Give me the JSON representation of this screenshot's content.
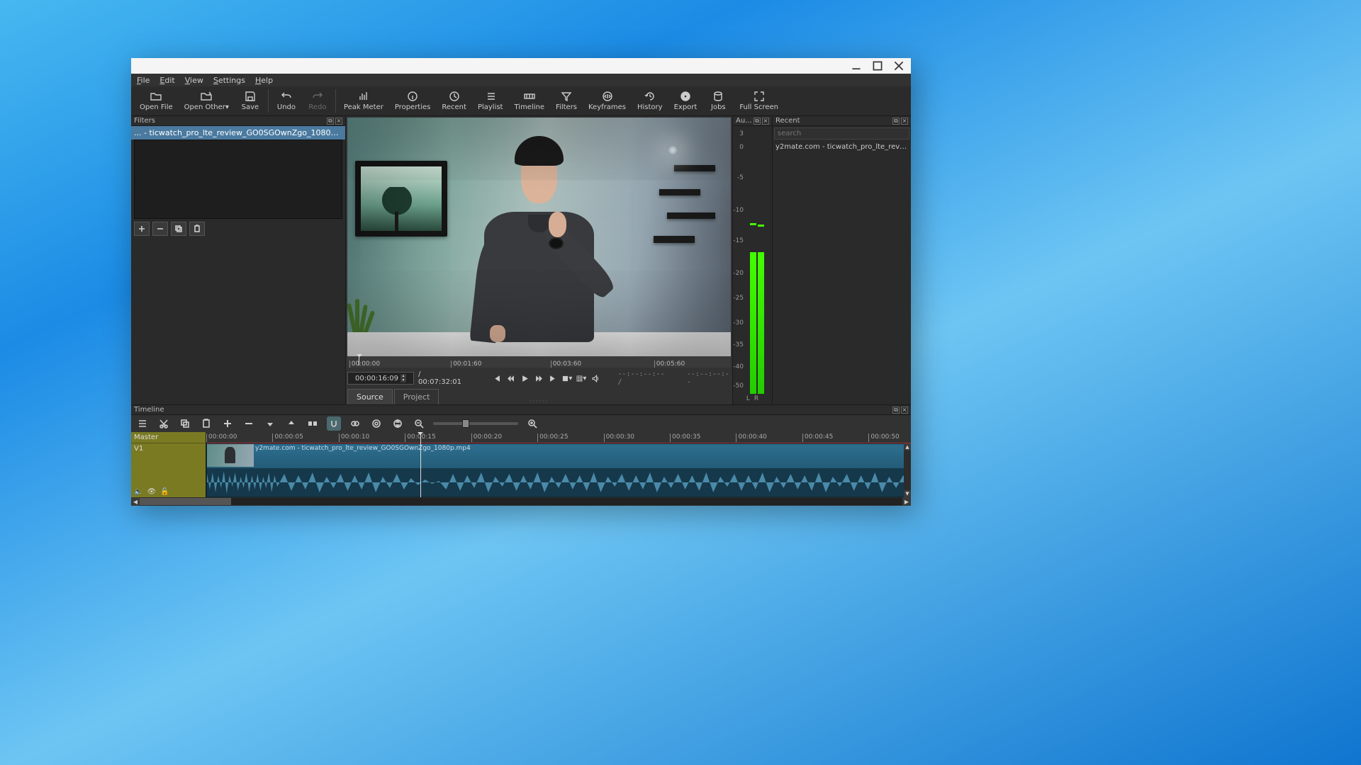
{
  "window": {
    "minimize": "_",
    "maximize": "□",
    "close": "×"
  },
  "menu": [
    "File",
    "Edit",
    "View",
    "Settings",
    "Help"
  ],
  "toolbar": [
    {
      "label": "Open File",
      "icon": "open"
    },
    {
      "label": "Open Other",
      "icon": "open-other",
      "dropdown": true
    },
    {
      "label": "Save",
      "icon": "save"
    },
    {
      "sep": true
    },
    {
      "label": "Undo",
      "icon": "undo"
    },
    {
      "label": "Redo",
      "icon": "redo",
      "disabled": true
    },
    {
      "sep": true
    },
    {
      "label": "Peak Meter",
      "icon": "peak"
    },
    {
      "label": "Properties",
      "icon": "info"
    },
    {
      "label": "Recent",
      "icon": "clock"
    },
    {
      "label": "Playlist",
      "icon": "list"
    },
    {
      "label": "Timeline",
      "icon": "timeline"
    },
    {
      "label": "Filters",
      "icon": "filter"
    },
    {
      "label": "Keyframes",
      "icon": "keyframe"
    },
    {
      "label": "History",
      "icon": "history"
    },
    {
      "label": "Export",
      "icon": "export"
    },
    {
      "label": "Jobs",
      "icon": "jobs"
    },
    {
      "label": "Full Screen",
      "icon": "fullscreen"
    }
  ],
  "filters": {
    "title": "Filters",
    "source": "... - ticwatch_pro_lte_review_GO0SGOwnZgo_1080p.mp4"
  },
  "scrub": {
    "ticks": [
      "00:00:00",
      "00:01:60",
      "00:03:60",
      "00:05:60"
    ]
  },
  "transport": {
    "current": "00:00:16:09",
    "total": "/ 00:07:32:01",
    "inpoint": "--:--:--:-- /",
    "outpoint": "--:--:--:--"
  },
  "tabs": {
    "source": "Source",
    "project": "Project"
  },
  "meter": {
    "title": "Au...",
    "scale": [
      "3",
      "0",
      "-5",
      "-10",
      "-15",
      "-20",
      "-25",
      "-30",
      "-35",
      "-40",
      "-50"
    ],
    "L": "L",
    "R": "R"
  },
  "recent": {
    "title": "Recent",
    "placeholder": "search",
    "items": [
      "y2mate.com - ticwatch_pro_lte_review_..."
    ]
  },
  "timeline": {
    "title": "Timeline",
    "master": "Master",
    "track": "V1",
    "ruler": [
      "00:00:00",
      "00:00:05",
      "00:00:10",
      "00:00:15",
      "00:00:20",
      "00:00:25",
      "00:00:30",
      "00:00:35",
      "00:00:40",
      "00:00:45",
      "00:00:50"
    ],
    "clip": "y2mate.com - ticwatch_pro_lte_review_GO0SGOwnZgo_1080p.mp4",
    "playhead_pct": 30.4
  }
}
